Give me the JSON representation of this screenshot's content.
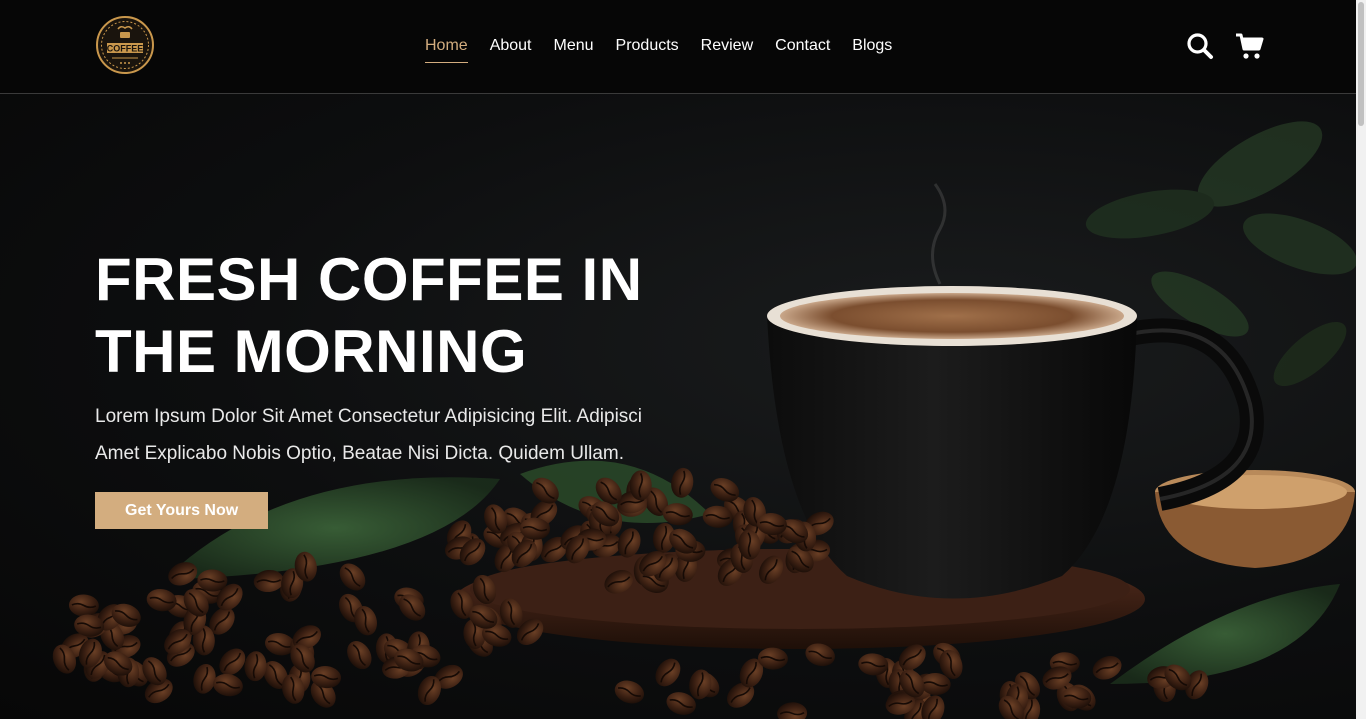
{
  "brand": {
    "logo_text": "COFFEE",
    "accent": "#d3ad7f"
  },
  "nav": {
    "items": [
      {
        "label": "Home",
        "active": true
      },
      {
        "label": "About"
      },
      {
        "label": "Menu"
      },
      {
        "label": "Products"
      },
      {
        "label": "Review"
      },
      {
        "label": "Contact"
      },
      {
        "label": "Blogs"
      }
    ]
  },
  "header_icons": [
    "search-icon",
    "cart-icon"
  ],
  "hero": {
    "title_line1": "FRESH COFFEE IN",
    "title_line2": "THE MORNING",
    "text": "Lorem Ipsum Dolor Sit Amet Consectetur Adipisicing Elit. Adipisci Amet Explicabo Nobis Optio, Beatae Nisi Dicta. Quidem Ullam.",
    "cta_label": "Get Yours Now"
  }
}
